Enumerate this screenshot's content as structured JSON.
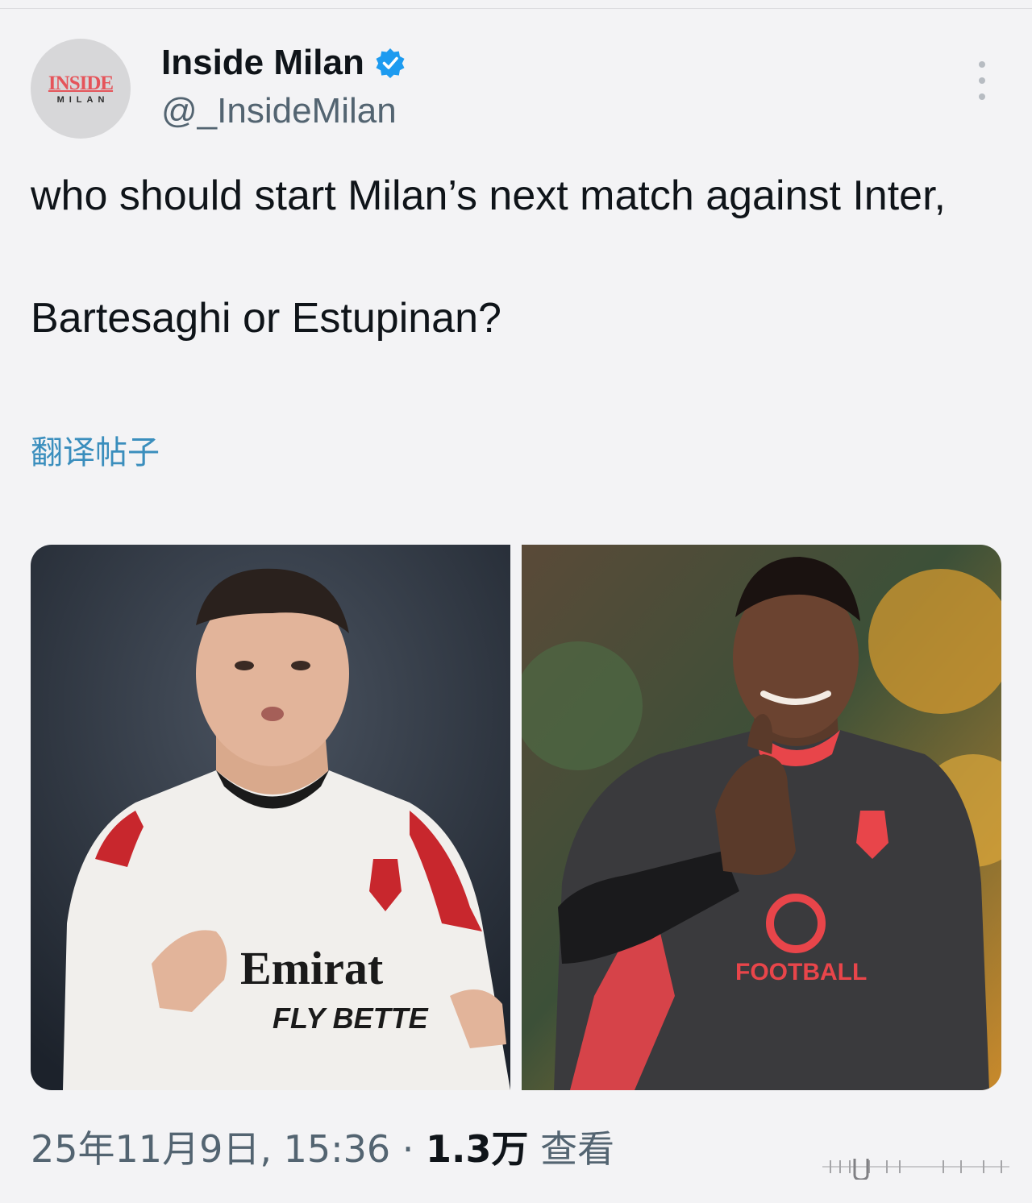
{
  "post": {
    "author": {
      "display_name": "Inside Milan",
      "handle": "@_InsideMilan",
      "avatar_logo_top": "INSIDE",
      "avatar_logo_bottom": "MILAN",
      "verified": true
    },
    "text_line1": "who should start Milan’s next match against Inter,",
    "text_line2": "Bartesaghi or Estupinan?",
    "translate_label": "翻译帖子",
    "media": [
      {
        "icon": "photo-player-white-kit",
        "shirt_text_1": "Emirat",
        "shirt_text_2": "FLY BETTE"
      },
      {
        "icon": "photo-player-thumbs-up",
        "shirt_text": "FOOTBALL"
      }
    ],
    "timestamp": "25年11月9日, 15:36",
    "separator": " · ",
    "views_count": "1.3万",
    "views_label": " 查看"
  },
  "colors": {
    "background": "#f3f3f5",
    "text_primary": "#0f1419",
    "text_secondary": "#536471",
    "link": "#3a8ebd",
    "verified": "#1d9bf0"
  }
}
